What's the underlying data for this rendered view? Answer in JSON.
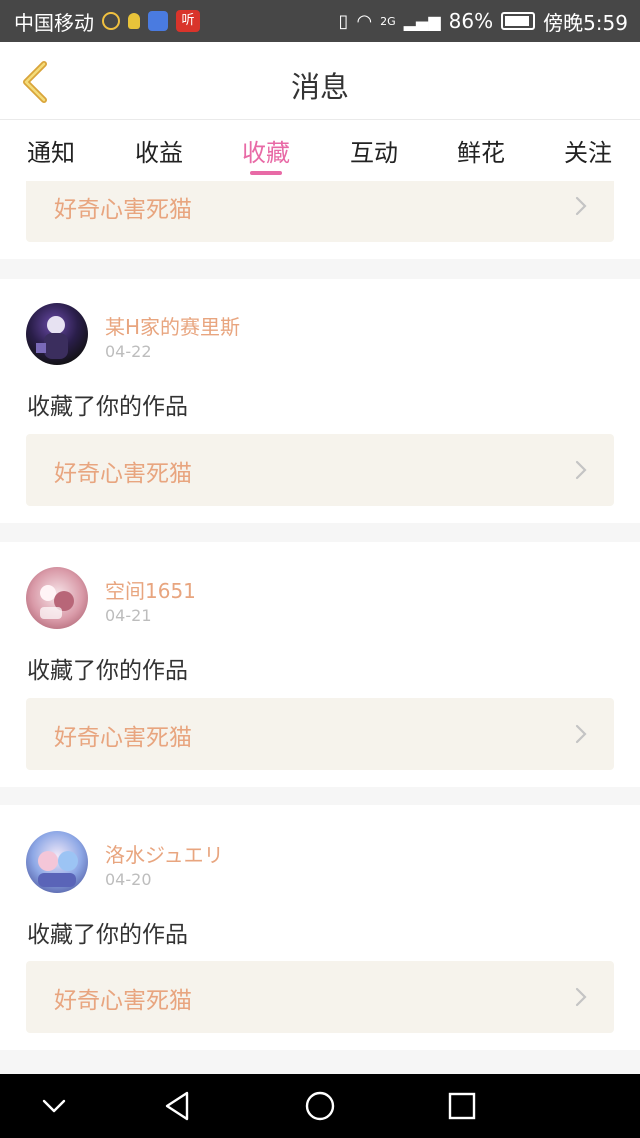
{
  "status": {
    "carrier": "中国移动",
    "signal_label": "2G",
    "battery": "86%",
    "time": "傍晚5:59",
    "app_icon_text": "听"
  },
  "header": {
    "title": "消息"
  },
  "tabs": [
    {
      "label": "通知",
      "active": false
    },
    {
      "label": "收益",
      "active": false
    },
    {
      "label": "收藏",
      "active": true
    },
    {
      "label": "互动",
      "active": false
    },
    {
      "label": "鲜花",
      "active": false
    },
    {
      "label": "关注",
      "active": false
    }
  ],
  "partial_item": {
    "work_title": "好奇心害死猫"
  },
  "items": [
    {
      "user": "某H家的赛里斯",
      "date": "04-22",
      "action": "收藏了你的作品",
      "work_title": "好奇心害死猫"
    },
    {
      "user": "空间1651",
      "date": "04-21",
      "action": "收藏了你的作品",
      "work_title": "好奇心害死猫"
    },
    {
      "user": "洛水ジュエリ",
      "date": "04-20",
      "action": "收藏了你的作品",
      "work_title": "好奇心害死猫"
    }
  ],
  "icons": {
    "back": "chevron-left-icon",
    "chevron": "chevron-right-icon",
    "nav": [
      "chevron-down-icon",
      "back-triangle-icon",
      "home-circle-icon",
      "recents-square-icon"
    ]
  },
  "colors": {
    "accent": "#e86aa6",
    "work_text": "#e8a57f",
    "back_icon": "#d9a43a"
  }
}
